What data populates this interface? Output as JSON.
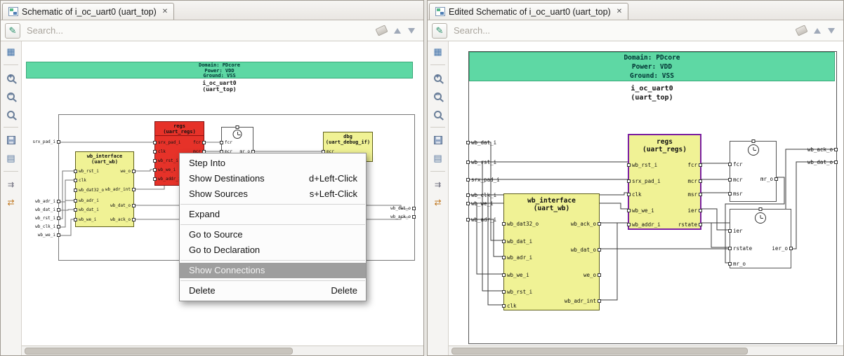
{
  "left": {
    "tab_title": "Schematic of i_oc_uart0 (uart_top)",
    "search_placeholder": "Search...",
    "sch": {
      "domain": "Domain: PDcore",
      "power": "Power: VDD",
      "ground": "Ground: VSS",
      "inst": "i_oc_uart0",
      "inst_type": "(uart_top)",
      "in_ports": [
        "srx_pad_i",
        "wb_adr_i",
        "wb_dat_i",
        "wb_rst_i",
        "wb_clk_i",
        "wb_we_i"
      ],
      "out_ports": [
        "wb_dat_o",
        "wb_ack_o"
      ],
      "regs": {
        "name": "regs",
        "type": "(uart_regs)",
        "in": [
          "srx_pad_i",
          "clk",
          "wb_rst_i",
          "wb_we_i",
          "wb_addr_i"
        ],
        "out": [
          "fcr",
          "mcr"
        ]
      },
      "sync": {
        "in": [
          "fcr",
          "mcr"
        ],
        "out": [
          "mr_o"
        ]
      },
      "dbg": {
        "name": "dbg",
        "type": "(uart_debug_if)",
        "in": [
          "mcr"
        ]
      },
      "wb": {
        "name": "wb_interface",
        "type": "(uart_wb)",
        "in": [
          "wb_rst_i",
          "clk",
          "wb_dat32_o",
          "wb_adr_i",
          "wb_dat_i",
          "wb_we_i"
        ],
        "out": [
          "we_o",
          "wb_adr_int",
          "wb_dat_o",
          "wb_ack_o"
        ]
      }
    },
    "menu": {
      "items": [
        {
          "label": "Step Into",
          "shortcut": ""
        },
        {
          "label": "Show Destinations",
          "shortcut": "d+Left-Click"
        },
        {
          "label": "Show Sources",
          "shortcut": "s+Left-Click"
        },
        {
          "label": "Expand",
          "shortcut": ""
        },
        {
          "label": "Go to Source",
          "shortcut": ""
        },
        {
          "label": "Go to Declaration",
          "shortcut": ""
        },
        {
          "label": "Show Connections",
          "shortcut": ""
        },
        {
          "label": "Delete",
          "shortcut": "Delete"
        }
      ]
    }
  },
  "right": {
    "tab_title": "Edited Schematic of i_oc_uart0 (uart_top)",
    "search_placeholder": "Search...",
    "sch": {
      "domain": "Domain: PDcore",
      "power": "Power: VDD",
      "ground": "Ground: VSS",
      "inst": "i_oc_uart0",
      "inst_type": "(uart_top)",
      "in_ports": [
        "wb_dat_i",
        "wb_rst_i",
        "srx_pad_i",
        "wb_clk_i",
        "wb_we_i",
        "wb_adr_i"
      ],
      "out_ports": [
        "wb_ack_o",
        "wb_dat_o"
      ],
      "regs": {
        "name": "regs",
        "type": "(uart_regs)",
        "in": [
          "wb_rst_i",
          "srx_pad_i",
          "clk",
          "wb_we_i",
          "wb_addr_i"
        ],
        "out": [
          "fcr",
          "mcr",
          "msr",
          "ier",
          "rstate"
        ]
      },
      "sync1": {
        "in": [
          "fcr",
          "mcr",
          "msr"
        ],
        "out": [
          "mr_o"
        ]
      },
      "sync2": {
        "in": [
          "ier",
          "rstate",
          "mr_o"
        ],
        "out": [
          "ier_o"
        ]
      },
      "wb": {
        "name": "wb_interface",
        "type": "(uart_wb)",
        "in": [
          "wb_dat32_o",
          "wb_dat_i",
          "wb_adr_i",
          "wb_we_i",
          "wb_rst_i",
          "clk"
        ],
        "out": [
          "wb_ack_o",
          "wb_dat_o",
          "we_o",
          "wb_adr_int"
        ]
      }
    }
  },
  "icons": {
    "tab": "schematic-icon",
    "toolbar_left": [
      "overview-grid-icon",
      "zoom-in-icon",
      "zoom-out-icon",
      "zoom-reset-icon",
      "save-icon",
      "properties-icon",
      "port-arrows-icon",
      "sync-arrows-icon"
    ],
    "search_right": [
      "clear-eraser-icon",
      "prev-match-icon",
      "next-match-icon"
    ]
  },
  "colors": {
    "domain_green": "#5ed8a4",
    "block_yellow": "#f0f295",
    "regs_red": "#e63229",
    "selected_purple": "#7b1fa2",
    "menu_highlight": "#9e9e9e"
  }
}
